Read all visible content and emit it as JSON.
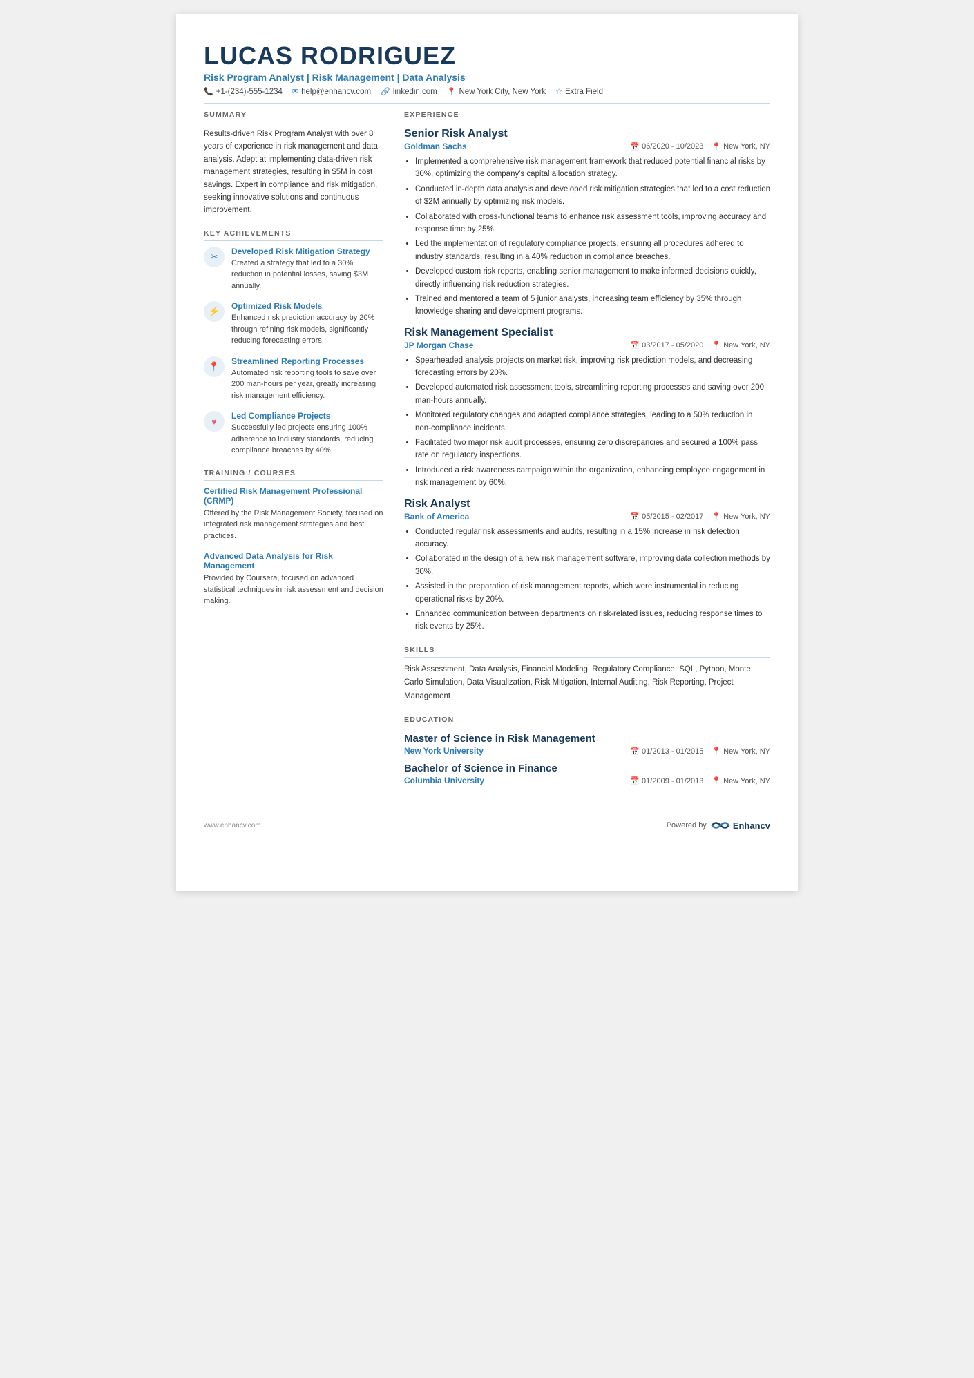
{
  "header": {
    "name": "LUCAS RODRIGUEZ",
    "title": "Risk Program Analyst | Risk Management | Data Analysis",
    "phone": "+1-(234)-555-1234",
    "email": "help@enhancv.com",
    "linkedin": "linkedin.com",
    "location": "New York City, New York",
    "extra": "Extra Field"
  },
  "summary": {
    "label": "SUMMARY",
    "text": "Results-driven Risk Program Analyst with over 8 years of experience in risk management and data analysis. Adept at implementing data-driven risk management strategies, resulting in $5M in cost savings. Expert in compliance and risk mitigation, seeking innovative solutions and continuous improvement."
  },
  "achievements": {
    "label": "KEY ACHIEVEMENTS",
    "items": [
      {
        "icon": "✂",
        "title": "Developed Risk Mitigation Strategy",
        "desc": "Created a strategy that led to a 30% reduction in potential losses, saving $3M annually."
      },
      {
        "icon": "⚡",
        "title": "Optimized Risk Models",
        "desc": "Enhanced risk prediction accuracy by 20% through refining risk models, significantly reducing forecasting errors."
      },
      {
        "icon": "📍",
        "title": "Streamlined Reporting Processes",
        "desc": "Automated risk reporting tools to save over 200 man-hours per year, greatly increasing risk management efficiency."
      },
      {
        "icon": "♥",
        "title": "Led Compliance Projects",
        "desc": "Successfully led projects ensuring 100% adherence to industry standards, reducing compliance breaches by 40%."
      }
    ]
  },
  "training": {
    "label": "TRAINING / COURSES",
    "items": [
      {
        "title": "Certified Risk Management Professional (CRMP)",
        "desc": "Offered by the Risk Management Society, focused on integrated risk management strategies and best practices."
      },
      {
        "title": "Advanced Data Analysis for Risk Management",
        "desc": "Provided by Coursera, focused on advanced statistical techniques in risk assessment and decision making."
      }
    ]
  },
  "experience": {
    "label": "EXPERIENCE",
    "jobs": [
      {
        "title": "Senior Risk Analyst",
        "company": "Goldman Sachs",
        "date": "06/2020 - 10/2023",
        "location": "New York, NY",
        "bullets": [
          "Implemented a comprehensive risk management framework that reduced potential financial risks by 30%, optimizing the company's capital allocation strategy.",
          "Conducted in-depth data analysis and developed risk mitigation strategies that led to a cost reduction of $2M annually by optimizing risk models.",
          "Collaborated with cross-functional teams to enhance risk assessment tools, improving accuracy and response time by 25%.",
          "Led the implementation of regulatory compliance projects, ensuring all procedures adhered to industry standards, resulting in a 40% reduction in compliance breaches.",
          "Developed custom risk reports, enabling senior management to make informed decisions quickly, directly influencing risk reduction strategies.",
          "Trained and mentored a team of 5 junior analysts, increasing team efficiency by 35% through knowledge sharing and development programs."
        ]
      },
      {
        "title": "Risk Management Specialist",
        "company": "JP Morgan Chase",
        "date": "03/2017 - 05/2020",
        "location": "New York, NY",
        "bullets": [
          "Spearheaded analysis projects on market risk, improving risk prediction models, and decreasing forecasting errors by 20%.",
          "Developed automated risk assessment tools, streamlining reporting processes and saving over 200 man-hours annually.",
          "Monitored regulatory changes and adapted compliance strategies, leading to a 50% reduction in non-compliance incidents.",
          "Facilitated two major risk audit processes, ensuring zero discrepancies and secured a 100% pass rate on regulatory inspections.",
          "Introduced a risk awareness campaign within the organization, enhancing employee engagement in risk management by 60%."
        ]
      },
      {
        "title": "Risk Analyst",
        "company": "Bank of America",
        "date": "05/2015 - 02/2017",
        "location": "New York, NY",
        "bullets": [
          "Conducted regular risk assessments and audits, resulting in a 15% increase in risk detection accuracy.",
          "Collaborated in the design of a new risk management software, improving data collection methods by 30%.",
          "Assisted in the preparation of risk management reports, which were instrumental in reducing operational risks by 20%.",
          "Enhanced communication between departments on risk-related issues, reducing response times to risk events by 25%."
        ]
      }
    ]
  },
  "skills": {
    "label": "SKILLS",
    "text": "Risk Assessment, Data Analysis, Financial Modeling, Regulatory Compliance, SQL, Python, Monte Carlo Simulation, Data Visualization, Risk Mitigation, Internal Auditing, Risk Reporting, Project Management"
  },
  "education": {
    "label": "EDUCATION",
    "items": [
      {
        "degree": "Master of Science in Risk Management",
        "school": "New York University",
        "date": "01/2013 - 01/2015",
        "location": "New York, NY"
      },
      {
        "degree": "Bachelor of Science in Finance",
        "school": "Columbia University",
        "date": "01/2009 - 01/2013",
        "location": "New York, NY"
      }
    ]
  },
  "footer": {
    "website": "www.enhancv.com",
    "powered_by": "Powered by",
    "brand": "Enhancv"
  }
}
